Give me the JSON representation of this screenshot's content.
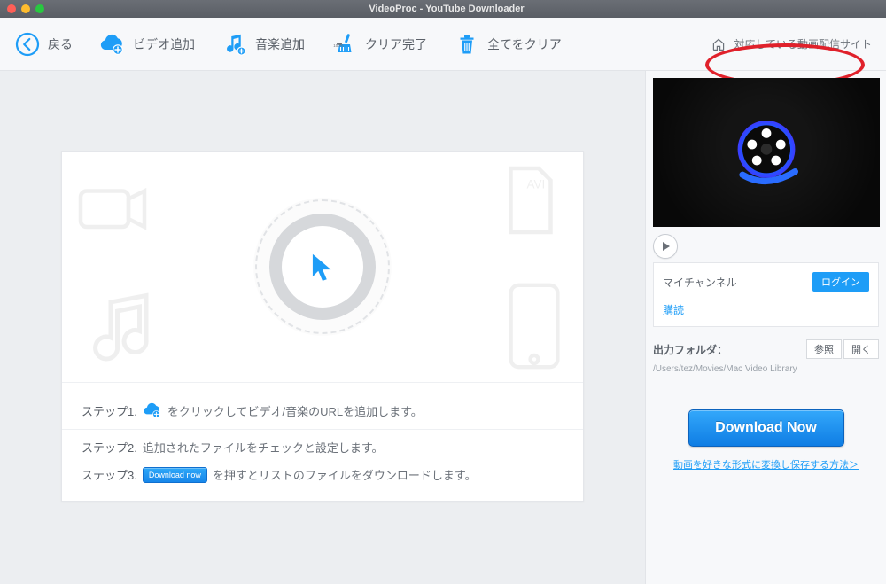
{
  "window": {
    "title": "VideoProc - YouTube Downloader"
  },
  "toolbar": {
    "back": "戻る",
    "add_video": "ビデオ追加",
    "add_music": "音楽追加",
    "clear_done": "クリア完了",
    "clear_all": "全てをクリア",
    "supported_sites": "対応している動画配信サイト"
  },
  "steps": {
    "s1_label": "ステップ1.",
    "s1_text_a": "をクリックしてビデオ/音楽のURLを追加します。",
    "s2_label": "ステップ2.",
    "s2_text": "追加されたファイルをチェックと設定します。",
    "s3_label": "ステップ3.",
    "s3_badge": "Download now",
    "s3_text": "を押すとリストのファイルをダウンロードします。"
  },
  "right": {
    "channel_label": "マイチャンネル",
    "login": "ログイン",
    "subscribe": "購読",
    "output_folder_label": "出力フォルダ：",
    "browse": "参照",
    "open": "開く",
    "output_path": "/Users/tez/Movies/Mac Video Library",
    "download_now": "Download Now",
    "convert_link": "動画を好きな形式に変換し保存する方法＞"
  }
}
